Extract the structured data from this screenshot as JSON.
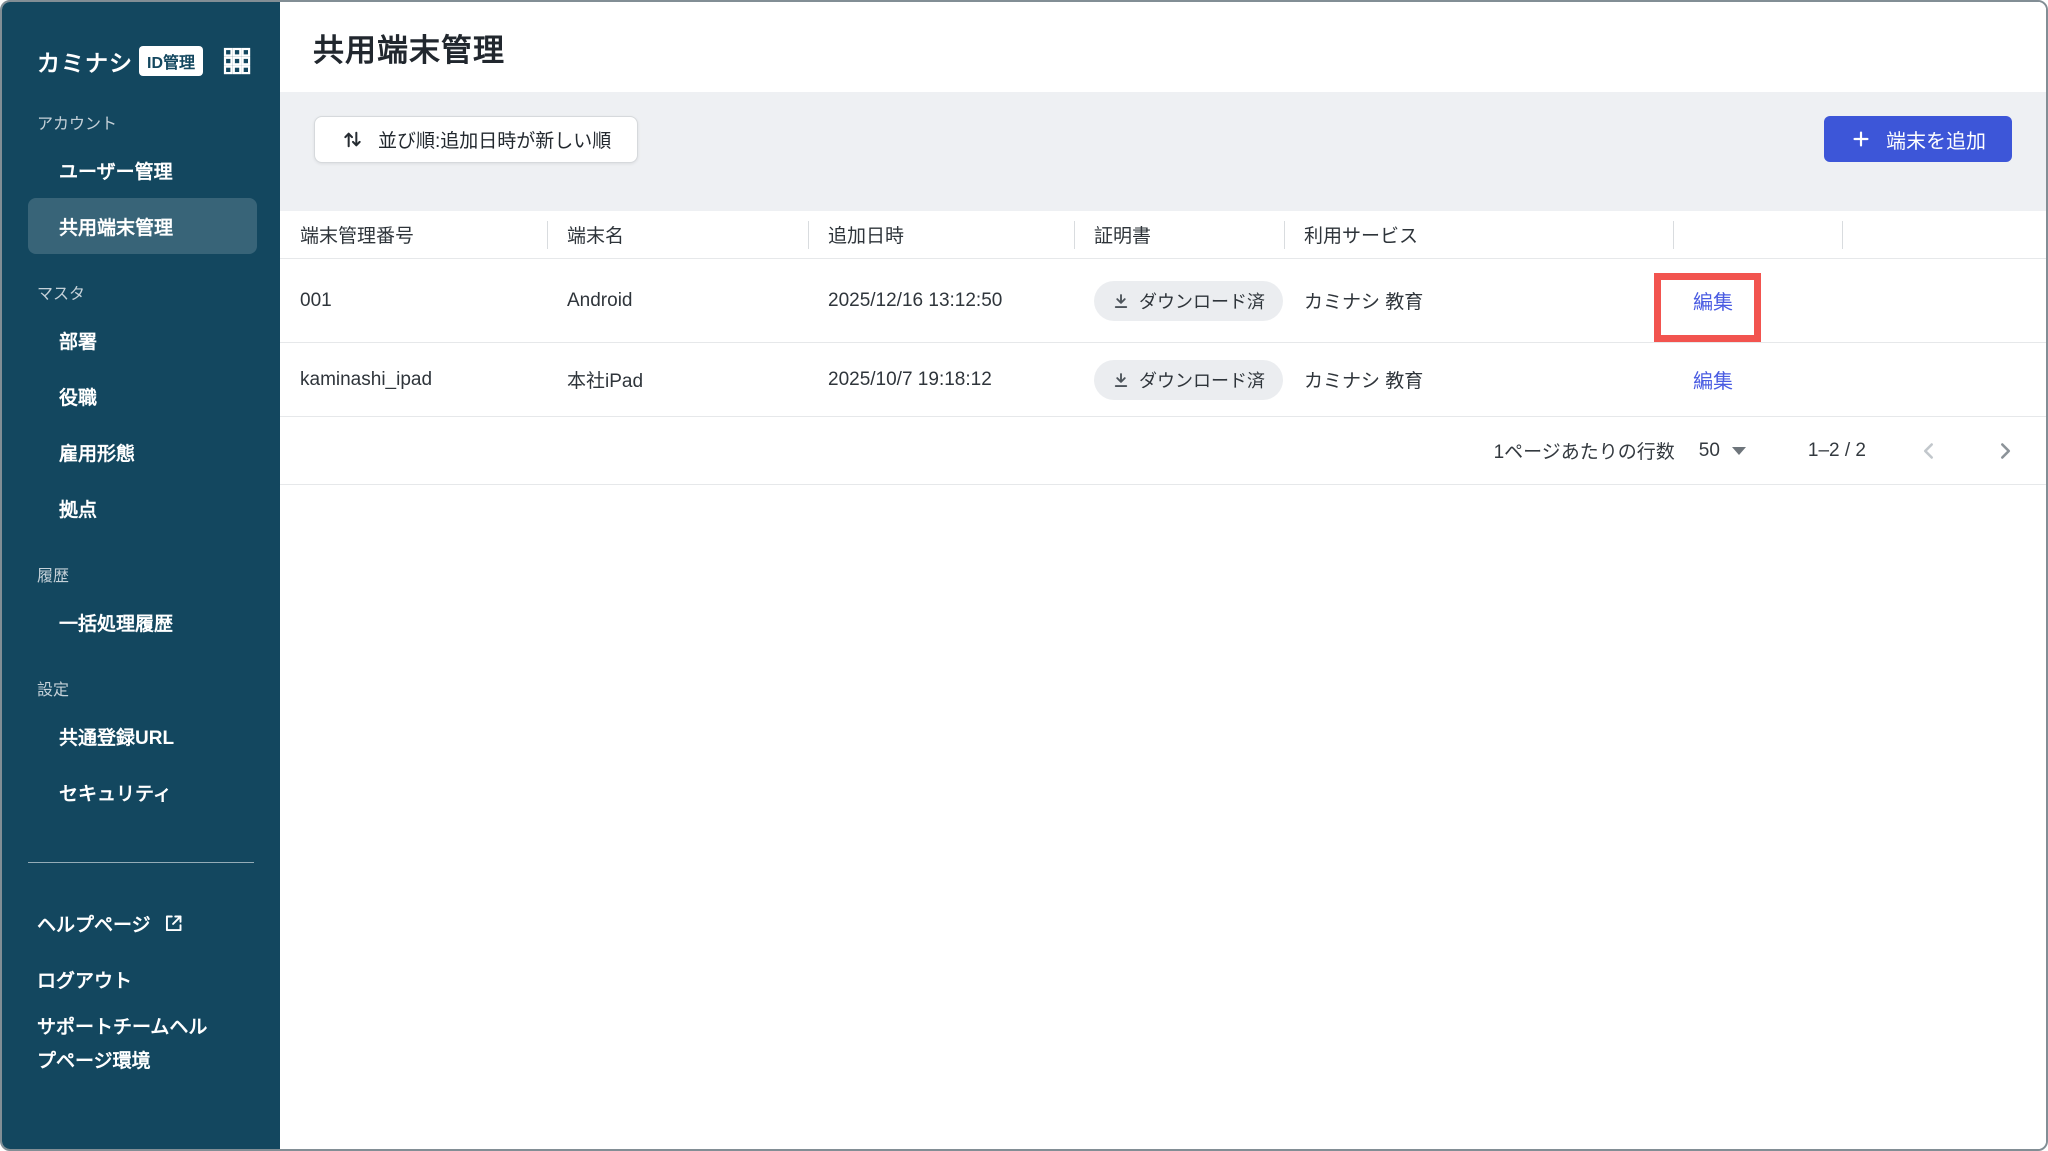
{
  "app": {
    "logo_text": "カミナシ",
    "logo_badge": "ID管理"
  },
  "sidebar": {
    "sections": [
      {
        "label": "アカウント",
        "items": [
          {
            "label": "ユーザー管理"
          },
          {
            "label": "共用端末管理",
            "active": true
          }
        ]
      },
      {
        "label": "マスタ",
        "items": [
          {
            "label": "部署"
          },
          {
            "label": "役職"
          },
          {
            "label": "雇用形態"
          },
          {
            "label": "拠点"
          }
        ]
      },
      {
        "label": "履歴",
        "items": [
          {
            "label": "一括処理履歴"
          }
        ]
      },
      {
        "label": "設定",
        "items": [
          {
            "label": "共通登録URL"
          },
          {
            "label": "セキュリティ"
          }
        ]
      }
    ],
    "footer": {
      "help": "ヘルプページ",
      "logout": "ログアウト",
      "support": "サポートチームヘルプページ環境"
    }
  },
  "header": {
    "title": "共用端末管理"
  },
  "toolbar": {
    "sort_label": "並び順:追加日時が新しい順",
    "add_button_label": "端末を追加"
  },
  "table": {
    "columns": [
      "端末管理番号",
      "端末名",
      "追加日時",
      "証明書",
      "利用サービス",
      "",
      ""
    ],
    "rows": [
      {
        "id": "001",
        "name": "Android",
        "added": "2025/12/16 13:12:50",
        "cert": "ダウンロード済",
        "service": "カミナシ 教育",
        "action": "編集"
      },
      {
        "id": "kaminashi_ipad",
        "name": "本社iPad",
        "added": "2025/10/7 19:18:12",
        "cert": "ダウンロード済",
        "service": "カミナシ 教育",
        "action": "編集"
      }
    ]
  },
  "pagination": {
    "rows_per_page_label": "1ページあたりの行数",
    "rows_per_page": "50",
    "range": "1–2 / 2"
  },
  "colors": {
    "sidebar_bg": "#13475F",
    "accent_blue": "#3D56D8",
    "link_blue": "#4A5CE2",
    "highlight_red": "#F2544F",
    "toolbar_bg": "#EEF0F3",
    "badge_bg": "#EBEDF0"
  }
}
